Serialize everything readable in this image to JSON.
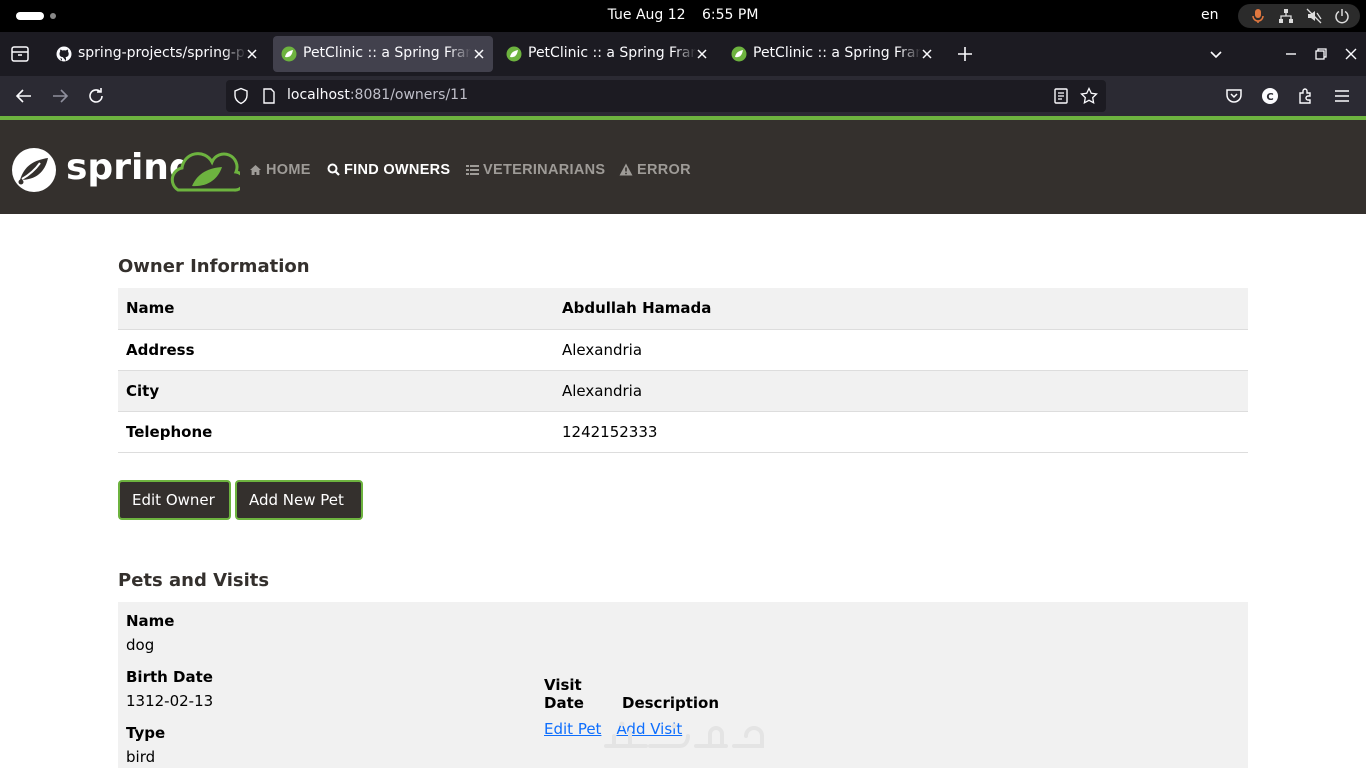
{
  "os": {
    "date": "Tue Aug 12",
    "time": "6:55 PM",
    "lang": "en"
  },
  "browser": {
    "tabs": [
      {
        "title": "spring-projects/spring-petclinic",
        "favicon": "github-icon",
        "active": false
      },
      {
        "title": "PetClinic :: a Spring Framework demonstration",
        "favicon": "spring-leaf-icon",
        "active": true
      },
      {
        "title": "PetClinic :: a Spring Framework demonstration",
        "favicon": "spring-leaf-icon",
        "active": false
      },
      {
        "title": "PetClinic :: a Spring Framework demonstration",
        "favicon": "spring-leaf-icon",
        "active": false
      }
    ],
    "url_host": "localhost",
    "url_rest": ":8081/owners/11"
  },
  "header": {
    "brand": "spring",
    "nav": {
      "home": "HOME",
      "find_owners": "FIND OWNERS",
      "veterinarians": "VETERINARIANS",
      "error": "ERROR"
    },
    "accent": "#6db33f",
    "background": "#34302d"
  },
  "owner": {
    "heading": "Owner Information",
    "rows": [
      {
        "label": "Name",
        "value": "Abdullah Hamada"
      },
      {
        "label": "Address",
        "value": "Alexandria"
      },
      {
        "label": "City",
        "value": "Alexandria"
      },
      {
        "label": "Telephone",
        "value": "1242152333"
      }
    ],
    "edit_button": "Edit Owner",
    "add_pet_button": "Add New Pet"
  },
  "pets": {
    "heading": "Pets and Visits",
    "items": [
      {
        "name_label": "Name",
        "name": "dog",
        "birth_label": "Birth Date",
        "birth": "1312-02-13",
        "type_label": "Type",
        "type": "bird",
        "visit_date_header": "Visit Date",
        "description_header": "Description",
        "edit_link": "Edit Pet",
        "add_visit_link": "Add Visit"
      }
    ]
  }
}
